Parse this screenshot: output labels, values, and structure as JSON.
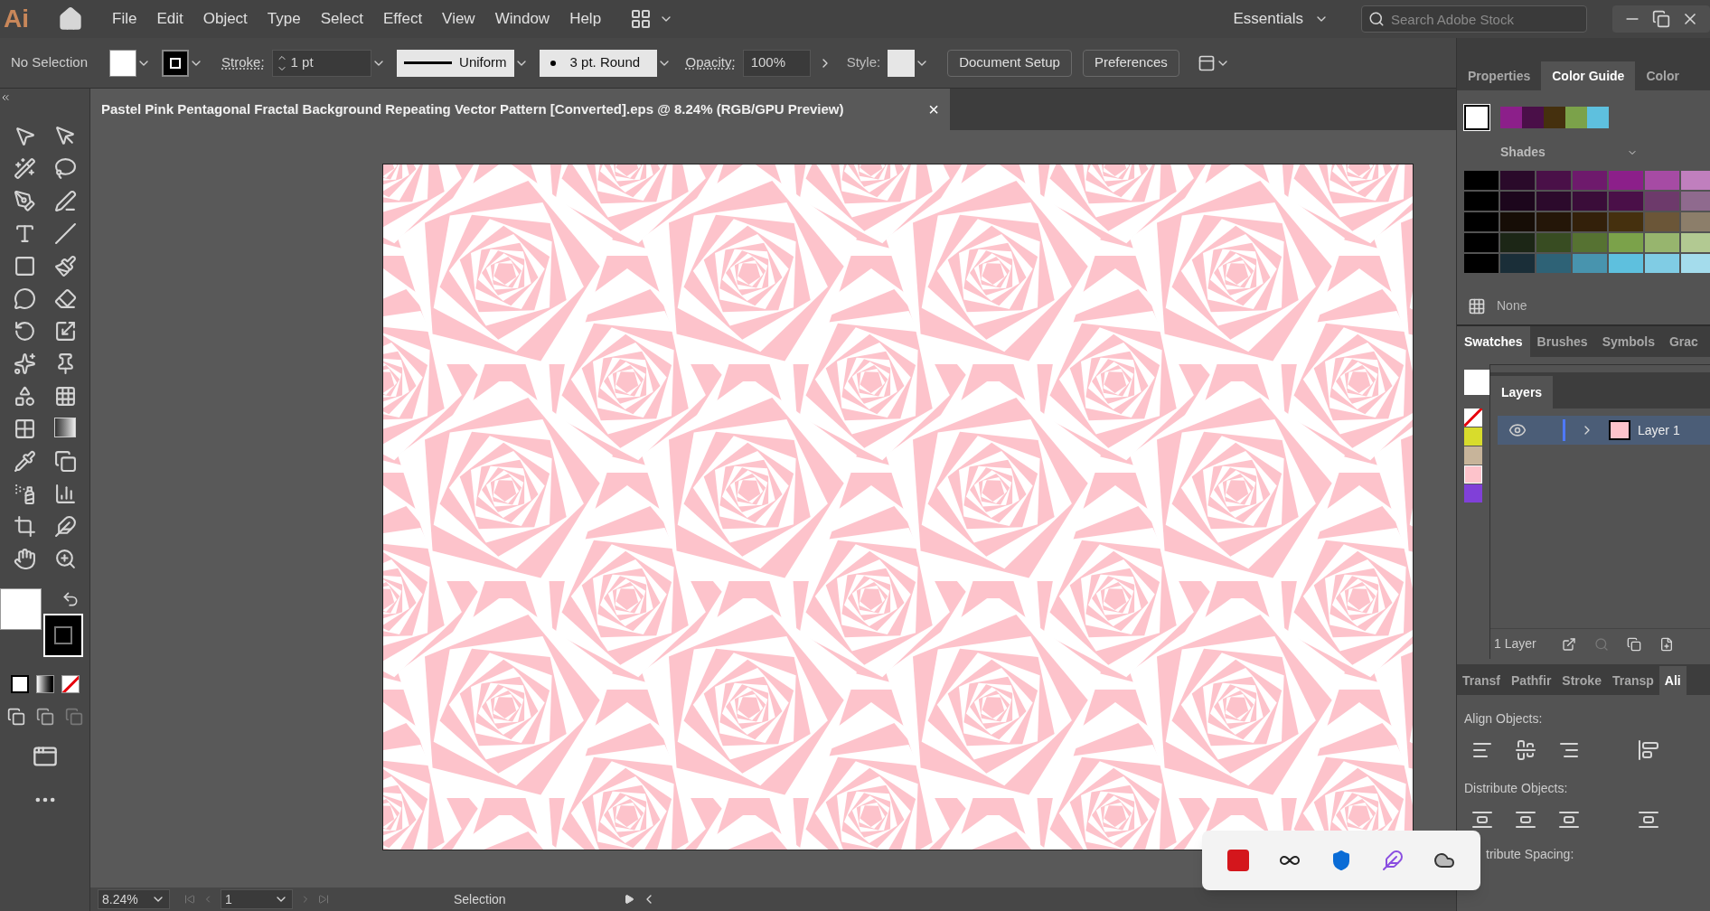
{
  "app_logo": "Ai",
  "menu": [
    "File",
    "Edit",
    "Object",
    "Type",
    "Select",
    "Effect",
    "View",
    "Window",
    "Help"
  ],
  "workspace": "Essentials",
  "stock_search": {
    "placeholder": "Search Adobe Stock"
  },
  "control_bar": {
    "selection": "No Selection",
    "stroke_label": "Stroke:",
    "stroke_weight": "1 pt",
    "profile": "Uniform",
    "brush": "3 pt. Round",
    "opacity_label": "Opacity:",
    "opacity": "100%",
    "style_label": "Style:",
    "buttons": [
      "Document Setup",
      "Preferences"
    ]
  },
  "document_tab": {
    "title": "Pastel Pink Pentagonal Fractal Background Repeating Vector Pattern [Converted].eps @ 8.24% (RGB/GPU Preview)",
    "close": "×"
  },
  "color_guide": {
    "tabs": [
      {
        "label": "Properties",
        "selected": false
      },
      {
        "label": "Color Guide",
        "selected": true
      },
      {
        "label": "Color",
        "selected": false
      }
    ],
    "harmony": [
      {
        "color": "#8c1f8a"
      },
      {
        "color": "#4a0f48"
      },
      {
        "color": "#45300e"
      },
      {
        "color": "#7ba24a"
      },
      {
        "color": "#5ec0de"
      }
    ],
    "mode": "Shades",
    "grid": [
      {
        "cells": [
          {
            "color": "#000000"
          },
          {
            "color": "#2a0a2a"
          },
          {
            "color": "#4a1048"
          },
          {
            "color": "#6e1a6c"
          },
          {
            "color": "#8c1f8a"
          },
          {
            "color": "#a64ba4"
          },
          {
            "color": "#c07fbe"
          }
        ]
      },
      {
        "cells": [
          {
            "color": "#000000"
          },
          {
            "color": "#1c061c"
          },
          {
            "color": "#2c0a2c"
          },
          {
            "color": "#3a0d39"
          },
          {
            "color": "#4a0f48"
          },
          {
            "color": "#6d3a6b"
          },
          {
            "color": "#8f6a8e"
          }
        ]
      },
      {
        "cells": [
          {
            "color": "#000000"
          },
          {
            "color": "#160d06"
          },
          {
            "color": "#241608"
          },
          {
            "color": "#33200a"
          },
          {
            "color": "#45300e"
          },
          {
            "color": "#6b5638"
          },
          {
            "color": "#8c7e6a"
          }
        ]
      },
      {
        "cells": [
          {
            "color": "#000000"
          },
          {
            "color": "#1c2616"
          },
          {
            "color": "#384c22"
          },
          {
            "color": "#567232"
          },
          {
            "color": "#7ba24a"
          },
          {
            "color": "#97b56e"
          },
          {
            "color": "#b2c992"
          }
        ]
      },
      {
        "cells": [
          {
            "color": "#000000"
          },
          {
            "color": "#1a2e38"
          },
          {
            "color": "#2e6276"
          },
          {
            "color": "#4894ae"
          },
          {
            "color": "#5ec0de"
          },
          {
            "color": "#80cce4"
          },
          {
            "color": "#a4dcec"
          }
        ]
      }
    ],
    "none_label": "None"
  },
  "swatches": {
    "tabs": [
      {
        "label": "Swatches",
        "selected": true
      },
      {
        "label": "Brushes",
        "selected": false
      },
      {
        "label": "Symbols",
        "selected": false
      },
      {
        "label": "Grac",
        "selected": false
      }
    ],
    "items": [
      {
        "kind": "none"
      },
      {
        "kind": "color",
        "color": "#d8dc2c"
      },
      {
        "kind": "color",
        "color": "#c7b49a"
      },
      {
        "kind": "pattern"
      },
      {
        "kind": "color",
        "color": "#8040d8"
      }
    ]
  },
  "layers": {
    "tab": "Layers",
    "rows": [
      {
        "name": "Layer 1",
        "visible": true,
        "selected": true
      }
    ],
    "count": "1 Layer"
  },
  "align": {
    "tabs": [
      {
        "label": "Transf",
        "selected": false
      },
      {
        "label": "Pathfir",
        "selected": false
      },
      {
        "label": "Stroke",
        "selected": false
      },
      {
        "label": "Transp",
        "selected": false
      },
      {
        "label": "Ali",
        "selected": true
      }
    ],
    "align_objects": "Align Objects:",
    "distribute_objects": "Distribute Objects:",
    "distribute_spacing": "tribute Spacing:"
  },
  "status": {
    "zoom": "8.24%",
    "artboard": "1",
    "tool": "Selection"
  }
}
